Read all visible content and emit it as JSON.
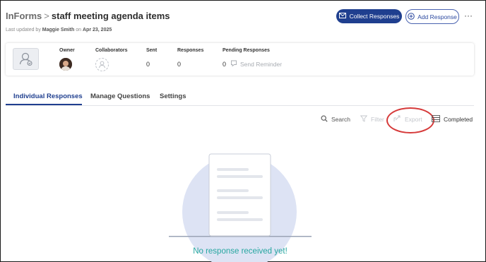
{
  "header": {
    "app_name": "InForms",
    "separator": ">",
    "form_title": "staff meeting agenda items",
    "updated_prefix": "Last updated by",
    "updated_by": "Maggie Smith",
    "updated_on_word": "on",
    "updated_date": "Apr 23, 2025",
    "collect_label": "Collect Responses",
    "add_label": "Add Response",
    "more_label": "···"
  },
  "summary": {
    "owner_label": "Owner",
    "collaborators_label": "Collaborators",
    "sent_label": "Sent",
    "sent_value": "0",
    "responses_label": "Responses",
    "responses_value": "0",
    "pending_label": "Pending Responses",
    "pending_value": "0",
    "send_reminder_label": "Send Reminder"
  },
  "tabs": [
    {
      "label": "Individual Responses",
      "active": true
    },
    {
      "label": "Manage Questions",
      "active": false
    },
    {
      "label": "Settings",
      "active": false
    }
  ],
  "toolbar": {
    "search_label": "Search",
    "filter_label": "Filter",
    "export_label": "Export",
    "status_label": "Completed"
  },
  "empty_state": {
    "message": "No response received yet!"
  },
  "colors": {
    "primary": "#1f3f8f",
    "highlight": "#d63a3a",
    "empty_text": "#26a6a0"
  }
}
